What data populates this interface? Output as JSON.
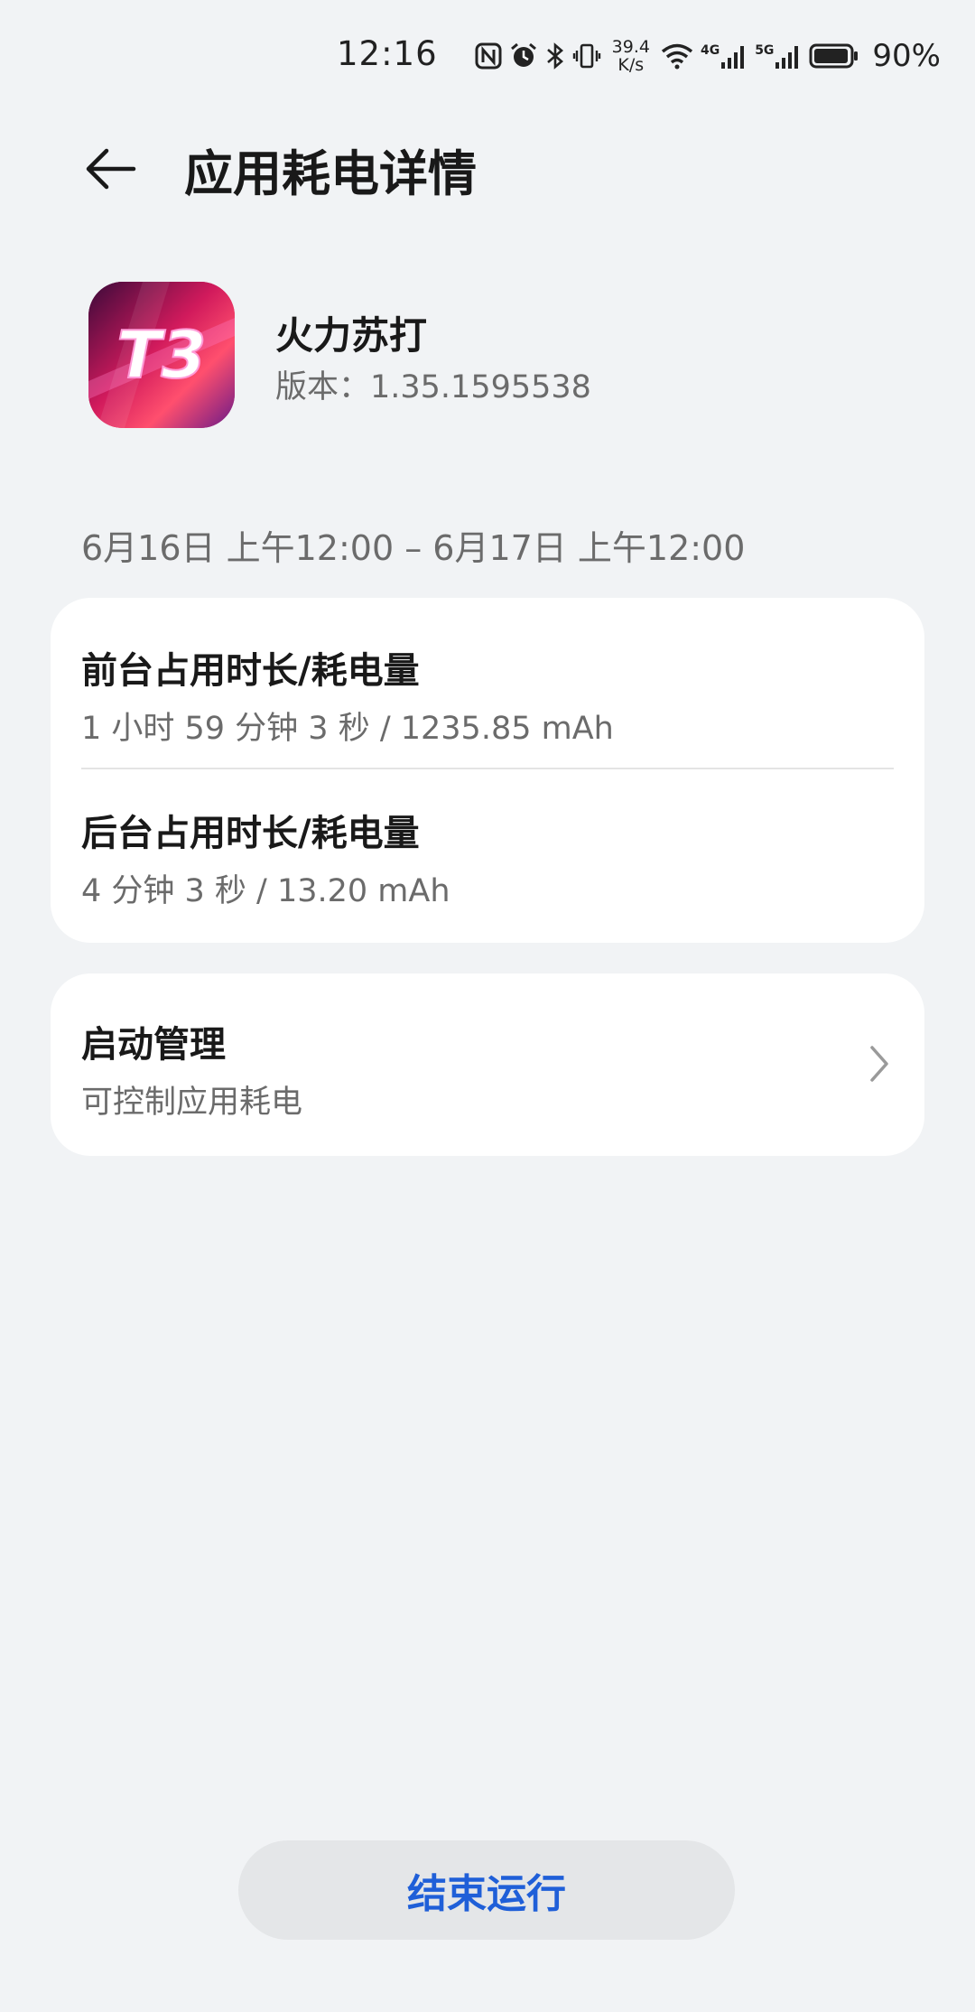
{
  "status_bar": {
    "time": "12:16",
    "net_speed_value": "39.4",
    "net_speed_unit": "K/s",
    "signal1_tag": "4G",
    "signal2_tag": "5G",
    "battery_percent": "90%",
    "icons": [
      "nfc-icon",
      "alarm-icon",
      "bluetooth-icon",
      "vibrate-icon",
      "wifi-icon",
      "signal-4g-icon",
      "signal-5g-icon",
      "battery-icon"
    ]
  },
  "header": {
    "title": "应用耗电详情",
    "back_icon": "arrow-left-icon"
  },
  "app": {
    "name": "火力苏打",
    "version": "版本：1.35.1595538",
    "icon_text": "T3"
  },
  "date_range": "6月16日 上午12:00 – 6月17日 上午12:00",
  "usage": {
    "foreground": {
      "title": "前台占用时长/耗电量",
      "value": "1 小时 59 分钟 3 秒 / 1235.85 mAh"
    },
    "background": {
      "title": "后台占用时长/耗电量",
      "value": "4 分钟 3 秒 / 13.20 mAh"
    }
  },
  "startup": {
    "title": "启动管理",
    "subtitle": "可控制应用耗电"
  },
  "actions": {
    "end_label": "结束运行"
  },
  "colors": {
    "background": "#f1f3f5",
    "card": "#ffffff",
    "accent": "#1f5fd8",
    "secondary_text": "#6b6b6b"
  }
}
